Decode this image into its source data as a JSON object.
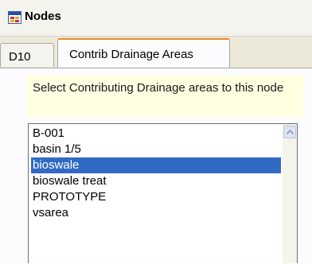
{
  "window": {
    "title": "Nodes",
    "icon": "window-app-icon"
  },
  "tabs": [
    {
      "label": "D10",
      "active": false
    },
    {
      "label": "Contrib Drainage Areas",
      "active": true
    }
  ],
  "prompt": {
    "text": "Select Contributing Drainage areas to this node"
  },
  "list": {
    "items": [
      "B-001",
      "basin 1/5",
      "bioswale",
      "bioswale treat",
      "PROTOTYPE",
      "vsarea"
    ],
    "selected_index": 2
  },
  "scrollbar": {
    "up_icon": "chevron-up-icon"
  },
  "colors": {
    "selection": "#316ac5",
    "prompt_bg": "#ffffe1",
    "tab_accent": "#e68b2c"
  }
}
